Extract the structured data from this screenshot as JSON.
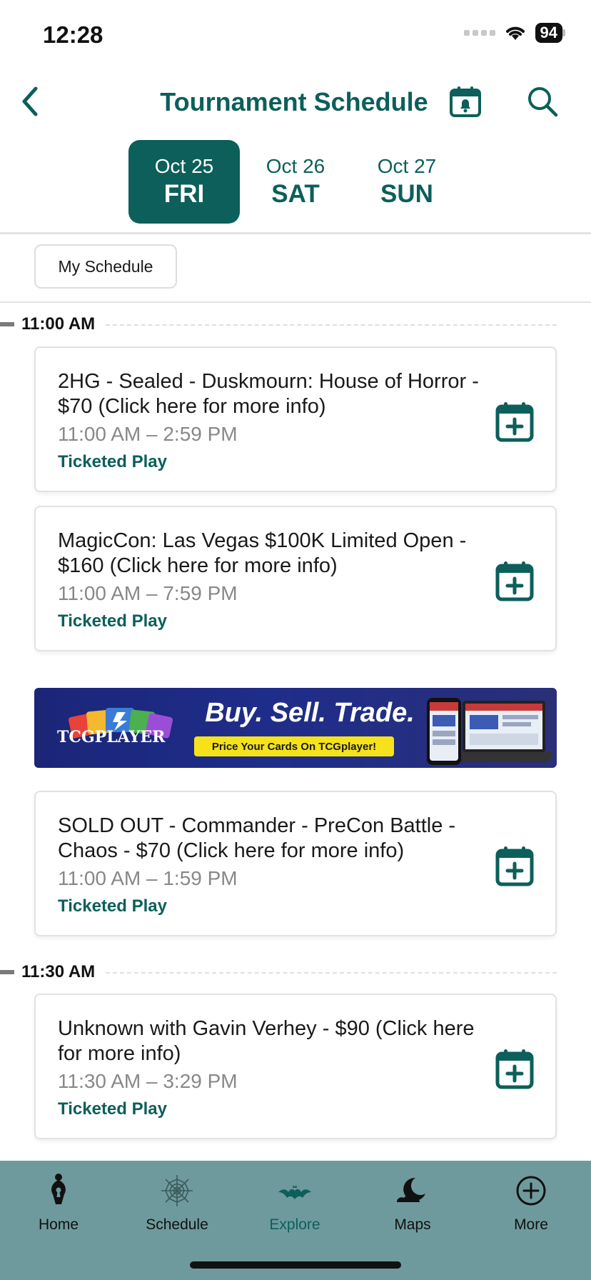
{
  "status_bar": {
    "time": "12:28",
    "battery": "94"
  },
  "header": {
    "title": "Tournament Schedule"
  },
  "date_tabs": [
    {
      "date": "Oct 25",
      "weekday": "FRI",
      "active": true
    },
    {
      "date": "Oct 26",
      "weekday": "SAT",
      "active": false
    },
    {
      "date": "Oct 27",
      "weekday": "SUN",
      "active": false
    }
  ],
  "filters": {
    "my_schedule_label": "My Schedule"
  },
  "time_groups": [
    {
      "time": "11:00 AM"
    },
    {
      "time": "11:30 AM"
    }
  ],
  "events": [
    {
      "title": "2HG - Sealed - Duskmourn: House of Horror - $70 (Click here for more info)",
      "time_range": "11:00 AM – 2:59 PM",
      "type": "Ticketed Play"
    },
    {
      "title": "MagicCon: Las Vegas $100K Limited Open - $160 (Click here for more info)",
      "time_range": "11:00 AM – 7:59 PM",
      "type": "Ticketed Play"
    },
    {
      "title": "SOLD OUT - Commander - PreCon Battle - Chaos - $70 (Click here for more info)",
      "time_range": "11:00 AM – 1:59 PM",
      "type": "Ticketed Play"
    },
    {
      "title": "Unknown with Gavin Verhey - $90 (Click here for more info)",
      "time_range": "11:30 AM – 3:29 PM",
      "type": "Ticketed Play"
    }
  ],
  "ad": {
    "logo_text": "TCGPLAYER",
    "headline": "Buy. Sell. Trade.",
    "cta": "Price Your Cards On TCGplayer!"
  },
  "tab_bar": [
    {
      "label": "Home",
      "icon": "keyhole-door-knocker-icon",
      "active": false
    },
    {
      "label": "Schedule",
      "icon": "spiderweb-icon",
      "active": false
    },
    {
      "label": "Explore",
      "icon": "bat-icon",
      "active": true
    },
    {
      "label": "Maps",
      "icon": "moon-cloud-icon",
      "active": false
    },
    {
      "label": "More",
      "icon": "plus-circle-icon",
      "active": false
    }
  ],
  "colors": {
    "brand": "#0c5f5a",
    "tab_bar_bg": "#6f9a9d",
    "ad_bg": "#1f2d8a",
    "ad_cta": "#f5e21b"
  }
}
